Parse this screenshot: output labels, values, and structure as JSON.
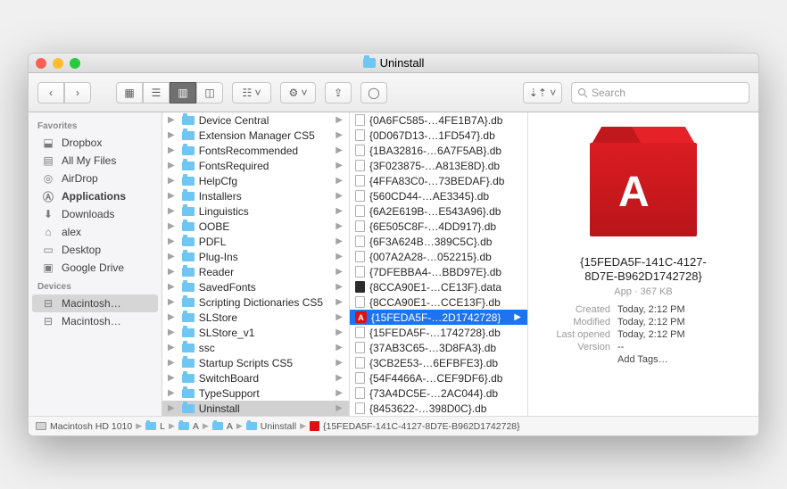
{
  "title": "Uninstall",
  "search_placeholder": "Search",
  "sidebar": {
    "favorites_label": "Favorites",
    "devices_label": "Devices",
    "favorites": [
      {
        "label": "Dropbox",
        "icon": "dropbox"
      },
      {
        "label": "All My Files",
        "icon": "allfiles"
      },
      {
        "label": "AirDrop",
        "icon": "airdrop"
      },
      {
        "label": "Applications",
        "icon": "apps",
        "bold": true
      },
      {
        "label": "Downloads",
        "icon": "downloads"
      },
      {
        "label": "alex",
        "icon": "home"
      },
      {
        "label": "Desktop",
        "icon": "desktop"
      },
      {
        "label": "Google Drive",
        "icon": "folder"
      }
    ],
    "devices": [
      {
        "label": "Macintosh…",
        "icon": "disk",
        "selected": true
      },
      {
        "label": "Macintosh…",
        "icon": "disk"
      }
    ]
  },
  "col1": [
    "Device Central",
    "Extension Manager CS5",
    "FontsRecommended",
    "FontsRequired",
    "HelpCfg",
    "Installers",
    "Linguistics",
    "OOBE",
    "PDFL",
    "Plug-Ins",
    "Reader",
    "SavedFonts",
    "Scripting Dictionaries CS5",
    "SLStore",
    "SLStore_v1",
    "ssc",
    "Startup Scripts CS5",
    "SwitchBoard",
    "TypeSupport",
    "Uninstall"
  ],
  "col1_selected_index": 19,
  "col2": [
    {
      "t": "file",
      "n": "{0A6FC585-…4FE1B7A}.db"
    },
    {
      "t": "file",
      "n": "{0D067D13-…1FD547}.db"
    },
    {
      "t": "file",
      "n": "{1BA32816-…6A7F5AB}.db"
    },
    {
      "t": "file",
      "n": "{3F023875-…A813E8D}.db"
    },
    {
      "t": "file",
      "n": "{4FFA83C0-…73BEDAF}.db"
    },
    {
      "t": "file",
      "n": "{560CD44-…AE3345}.db"
    },
    {
      "t": "file",
      "n": "{6A2E619B-…E543A96}.db"
    },
    {
      "t": "file",
      "n": "{6E505C8F-…4DD917}.db"
    },
    {
      "t": "file",
      "n": "{6F3A624B…389C5C}.db"
    },
    {
      "t": "file",
      "n": "{007A2A28-…052215}.db"
    },
    {
      "t": "file",
      "n": "{7DFEBBA4-…BBD97E}.db"
    },
    {
      "t": "data",
      "n": "{8CCA90E1-…CE13F}.data"
    },
    {
      "t": "file",
      "n": "{8CCA90E1-…CCE13F}.db"
    },
    {
      "t": "app",
      "n": "{15FEDA5F-…2D1742728}",
      "selected": true
    },
    {
      "t": "file",
      "n": "{15FEDA5F-…1742728}.db"
    },
    {
      "t": "file",
      "n": "{37AB3C65-…3D8FA3}.db"
    },
    {
      "t": "file",
      "n": "{3CB2E53-…6EFBFE3}.db"
    },
    {
      "t": "file",
      "n": "{54F4466A-…CEF9DF6}.db"
    },
    {
      "t": "file",
      "n": "{73A4DC5E-…2AC044}.db"
    },
    {
      "t": "file",
      "n": "{8453622-…398D0C}.db"
    }
  ],
  "preview": {
    "title1": "{15FEDA5F-141C-4127-",
    "title2": "8D7E-B962D1742728}",
    "kind": "App · 367 KB",
    "created_k": "Created",
    "created_v": "Today, 2:12 PM",
    "modified_k": "Modified",
    "modified_v": "Today, 2:12 PM",
    "opened_k": "Last opened",
    "opened_v": "Today, 2:12 PM",
    "version_k": "Version",
    "version_v": "--",
    "tags": "Add Tags…"
  },
  "pathbar": [
    {
      "icon": "disk",
      "label": "Macintosh HD 1010"
    },
    {
      "icon": "folder",
      "label": "L"
    },
    {
      "icon": "folder",
      "label": "A"
    },
    {
      "icon": "folder",
      "label": "A"
    },
    {
      "icon": "folder",
      "label": "Uninstall"
    },
    {
      "icon": "app",
      "label": "{15FEDA5F-141C-4127-8D7E-B962D1742728}"
    }
  ]
}
